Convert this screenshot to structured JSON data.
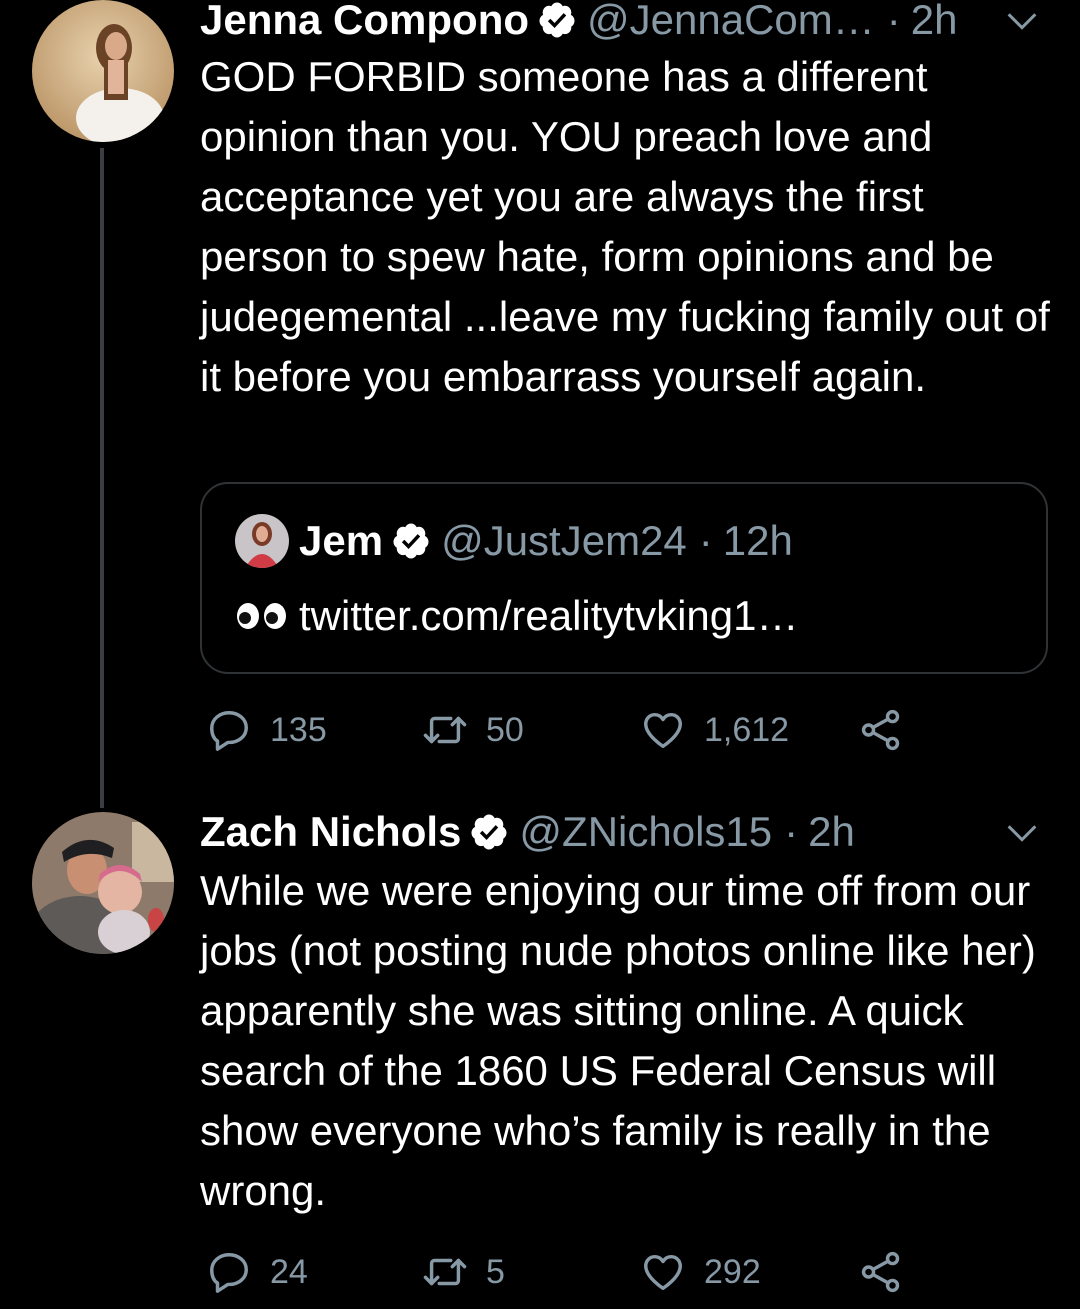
{
  "tweets": [
    {
      "name": "Jenna Compono",
      "handle": "@JennaCom…",
      "time": "2h",
      "text": "GOD FORBID someone has a different opinion than you. YOU preach love and acceptance yet you are always the first person to spew hate, form opinions and be judegemental ...leave my fucking family out of it before you embarrass yourself again.",
      "quote": {
        "name": "Jem",
        "handle": "@JustJem24",
        "time": "12h",
        "text": "twitter.com/realitytvking1…"
      },
      "replies": "135",
      "retweets": "50",
      "likes": "1,612"
    },
    {
      "name": "Zach Nichols",
      "handle": "@ZNichols15",
      "time": "2h",
      "text": "While we were enjoying our time off from our jobs (not posting nude photos online like her) apparently she was sitting online. A quick search of the 1860 US Federal Census will show everyone who’s family is really in the wrong.",
      "replies": "24",
      "retweets": "5",
      "likes": "292"
    }
  ],
  "separator": "·",
  "icons": {
    "verified": "verified-badge-icon",
    "caret": "chevron-down-icon",
    "reply": "reply-icon",
    "retweet": "retweet-icon",
    "like": "heart-icon",
    "share": "share-icon",
    "emoji": "eyes-emoji-icon"
  },
  "colors": {
    "background": "#000000",
    "text": "#ffffff",
    "muted": "#8899a6",
    "border": "#2f3336"
  }
}
